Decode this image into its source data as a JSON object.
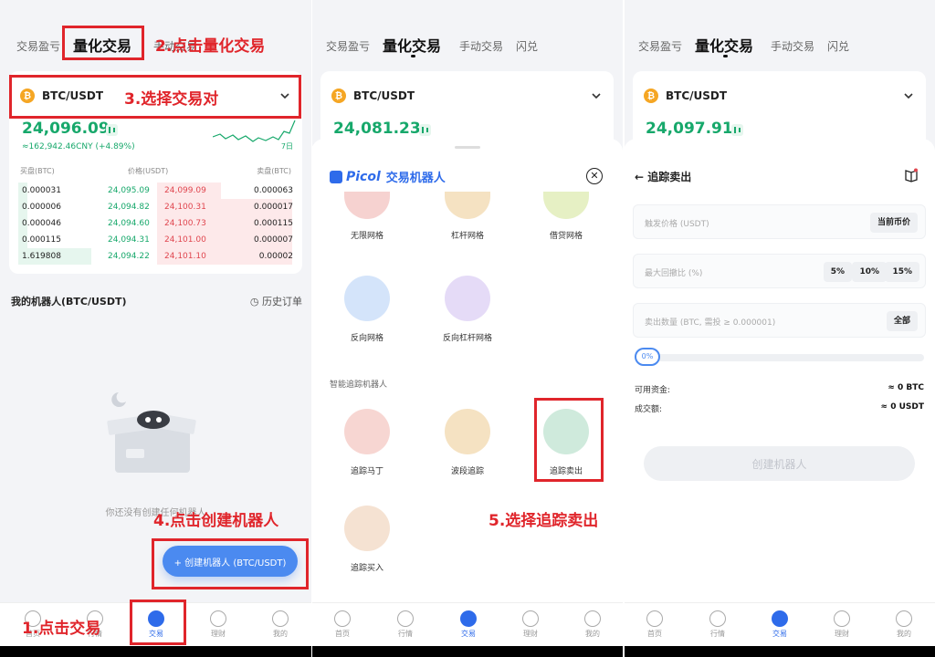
{
  "tabs": {
    "profit": "交易盈亏",
    "quant": "量化交易",
    "manual": "手动交易",
    "flash": "闪兑"
  },
  "pair": {
    "name": "BTC/USDT",
    "coin_glyph": "₿"
  },
  "panel1": {
    "price": "24,096.09",
    "sub": "≈162,942.46CNY (+4.89%)",
    "day_label": "7日",
    "orderbook_headers": {
      "bid": "买盘(BTC)",
      "price": "价格(USDT)",
      "ask": "卖盘(BTC)"
    },
    "orderbook": [
      {
        "bid": "0.000031",
        "bid_price": "24,095.09",
        "ask_price": "24,099.09",
        "ask": "0.000063"
      },
      {
        "bid": "0.000006",
        "bid_price": "24,094.82",
        "ask_price": "24,100.31",
        "ask": "0.000017"
      },
      {
        "bid": "0.000046",
        "bid_price": "24,094.60",
        "ask_price": "24,100.73",
        "ask": "0.000115"
      },
      {
        "bid": "0.000115",
        "bid_price": "24,094.31",
        "ask_price": "24,101.00",
        "ask": "0.000007"
      },
      {
        "bid": "1.619808",
        "bid_price": "24,094.22",
        "ask_price": "24,101.10",
        "ask": "0.00002"
      }
    ],
    "my_bots": "我的机器人(BTC/USDT)",
    "history": "历史订单",
    "empty_text": "你还没有创建任何机器人",
    "create_btn": "+ 创建机器人 (BTC/USDT)"
  },
  "panel2": {
    "price": "24,081.23",
    "brand": "Picol",
    "brand_sub": "交易机器人",
    "bots_row1": [
      "无限网格",
      "杠杆网格",
      "借贷网格"
    ],
    "bots_row2": [
      "反向网格",
      "反向杠杆网格"
    ],
    "smart_title": "智能追踪机器人",
    "bots_row3": [
      "追踪马丁",
      "波段追踪",
      "追踪卖出"
    ],
    "bots_row4": [
      "追踪买入"
    ]
  },
  "panel3": {
    "price": "24,097.91",
    "title": "追踪卖出",
    "trigger_placeholder": "触发价格 (USDT)",
    "current_price": "当前币价",
    "pullback_placeholder": "最大回撤比 (%)",
    "pct_options": [
      "5%",
      "10%",
      "15%"
    ],
    "amount_placeholder": "卖出数量 (BTC, 需投 ≥ 0.000001)",
    "all": "全部",
    "slider_value": "0%",
    "available_label": "可用资金:",
    "available_value": "≈ 0 BTC",
    "volume_label": "成交额:",
    "volume_value": "≈ 0 USDT",
    "create": "创建机器人"
  },
  "nav": {
    "home": "首页",
    "market": "行情",
    "trade": "交易",
    "finance": "理财",
    "me": "我的"
  },
  "annotations": {
    "a1": "1.点击交易",
    "a2": "2.点击量化交易",
    "a3": "3.选择交易对",
    "a4": "4.点击创建机器人",
    "a5": "5.选择追踪卖出"
  },
  "colors": {
    "accent": "#2e6bea",
    "green": "#17a86b",
    "red": "#e0464f",
    "annotation": "#e0252b"
  }
}
